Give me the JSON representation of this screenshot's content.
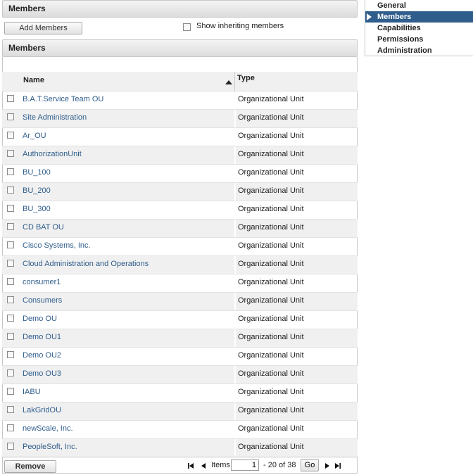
{
  "header": {
    "title": "Members"
  },
  "toolbar": {
    "add_label": "Add Members",
    "show_inheriting_label": "Show inheriting members",
    "show_inheriting_checked": false
  },
  "table": {
    "title": "Members",
    "columns": {
      "name": "Name",
      "type": "Type"
    },
    "sort": {
      "column": "Name",
      "direction": "asc"
    },
    "rows": [
      {
        "name": "B.A.T.Service Team OU",
        "type": "Organizational Unit"
      },
      {
        "name": "Site Administration",
        "type": "Organizational Unit"
      },
      {
        "name": "Ar_OU",
        "type": "Organizational Unit"
      },
      {
        "name": "AuthorizationUnit",
        "type": "Organizational Unit"
      },
      {
        "name": "BU_100",
        "type": "Organizational Unit"
      },
      {
        "name": "BU_200",
        "type": "Organizational Unit"
      },
      {
        "name": "BU_300",
        "type": "Organizational Unit"
      },
      {
        "name": "CD BAT OU",
        "type": "Organizational Unit"
      },
      {
        "name": "Cisco Systems, Inc.",
        "type": "Organizational Unit"
      },
      {
        "name": "Cloud Administration and Operations",
        "type": "Organizational Unit"
      },
      {
        "name": "consumer1",
        "type": "Organizational Unit"
      },
      {
        "name": "Consumers",
        "type": "Organizational Unit"
      },
      {
        "name": "Demo OU",
        "type": "Organizational Unit"
      },
      {
        "name": "Demo OU1",
        "type": "Organizational Unit"
      },
      {
        "name": "Demo OU2",
        "type": "Organizational Unit"
      },
      {
        "name": "Demo OU3",
        "type": "Organizational Unit"
      },
      {
        "name": "IABU",
        "type": "Organizational Unit"
      },
      {
        "name": "LakGridOU",
        "type": "Organizational Unit"
      },
      {
        "name": "newScale, Inc.",
        "type": "Organizational Unit"
      },
      {
        "name": "PeopleSoft, Inc.",
        "type": "Organizational Unit"
      }
    ]
  },
  "footer": {
    "remove_label": "Remove",
    "items_label": "Items",
    "page_value": "1",
    "range_text": "- 20  of 38",
    "go_label": "Go"
  },
  "nav": {
    "items": [
      {
        "label": "General",
        "active": false
      },
      {
        "label": "Members",
        "active": true
      },
      {
        "label": "Capabilities",
        "active": false
      },
      {
        "label": "Permissions",
        "active": false
      },
      {
        "label": "Administration",
        "active": false
      }
    ]
  },
  "colors": {
    "accent": "#2f5d8c",
    "link": "#2f5d8c",
    "row_alt": "#f0f0f0"
  },
  "icons": {
    "sort": "sort-ascending-icon",
    "first": "first-page-icon",
    "prev": "previous-page-icon",
    "next": "next-page-icon",
    "last": "last-page-icon",
    "nav_active": "arrow-right-icon"
  }
}
